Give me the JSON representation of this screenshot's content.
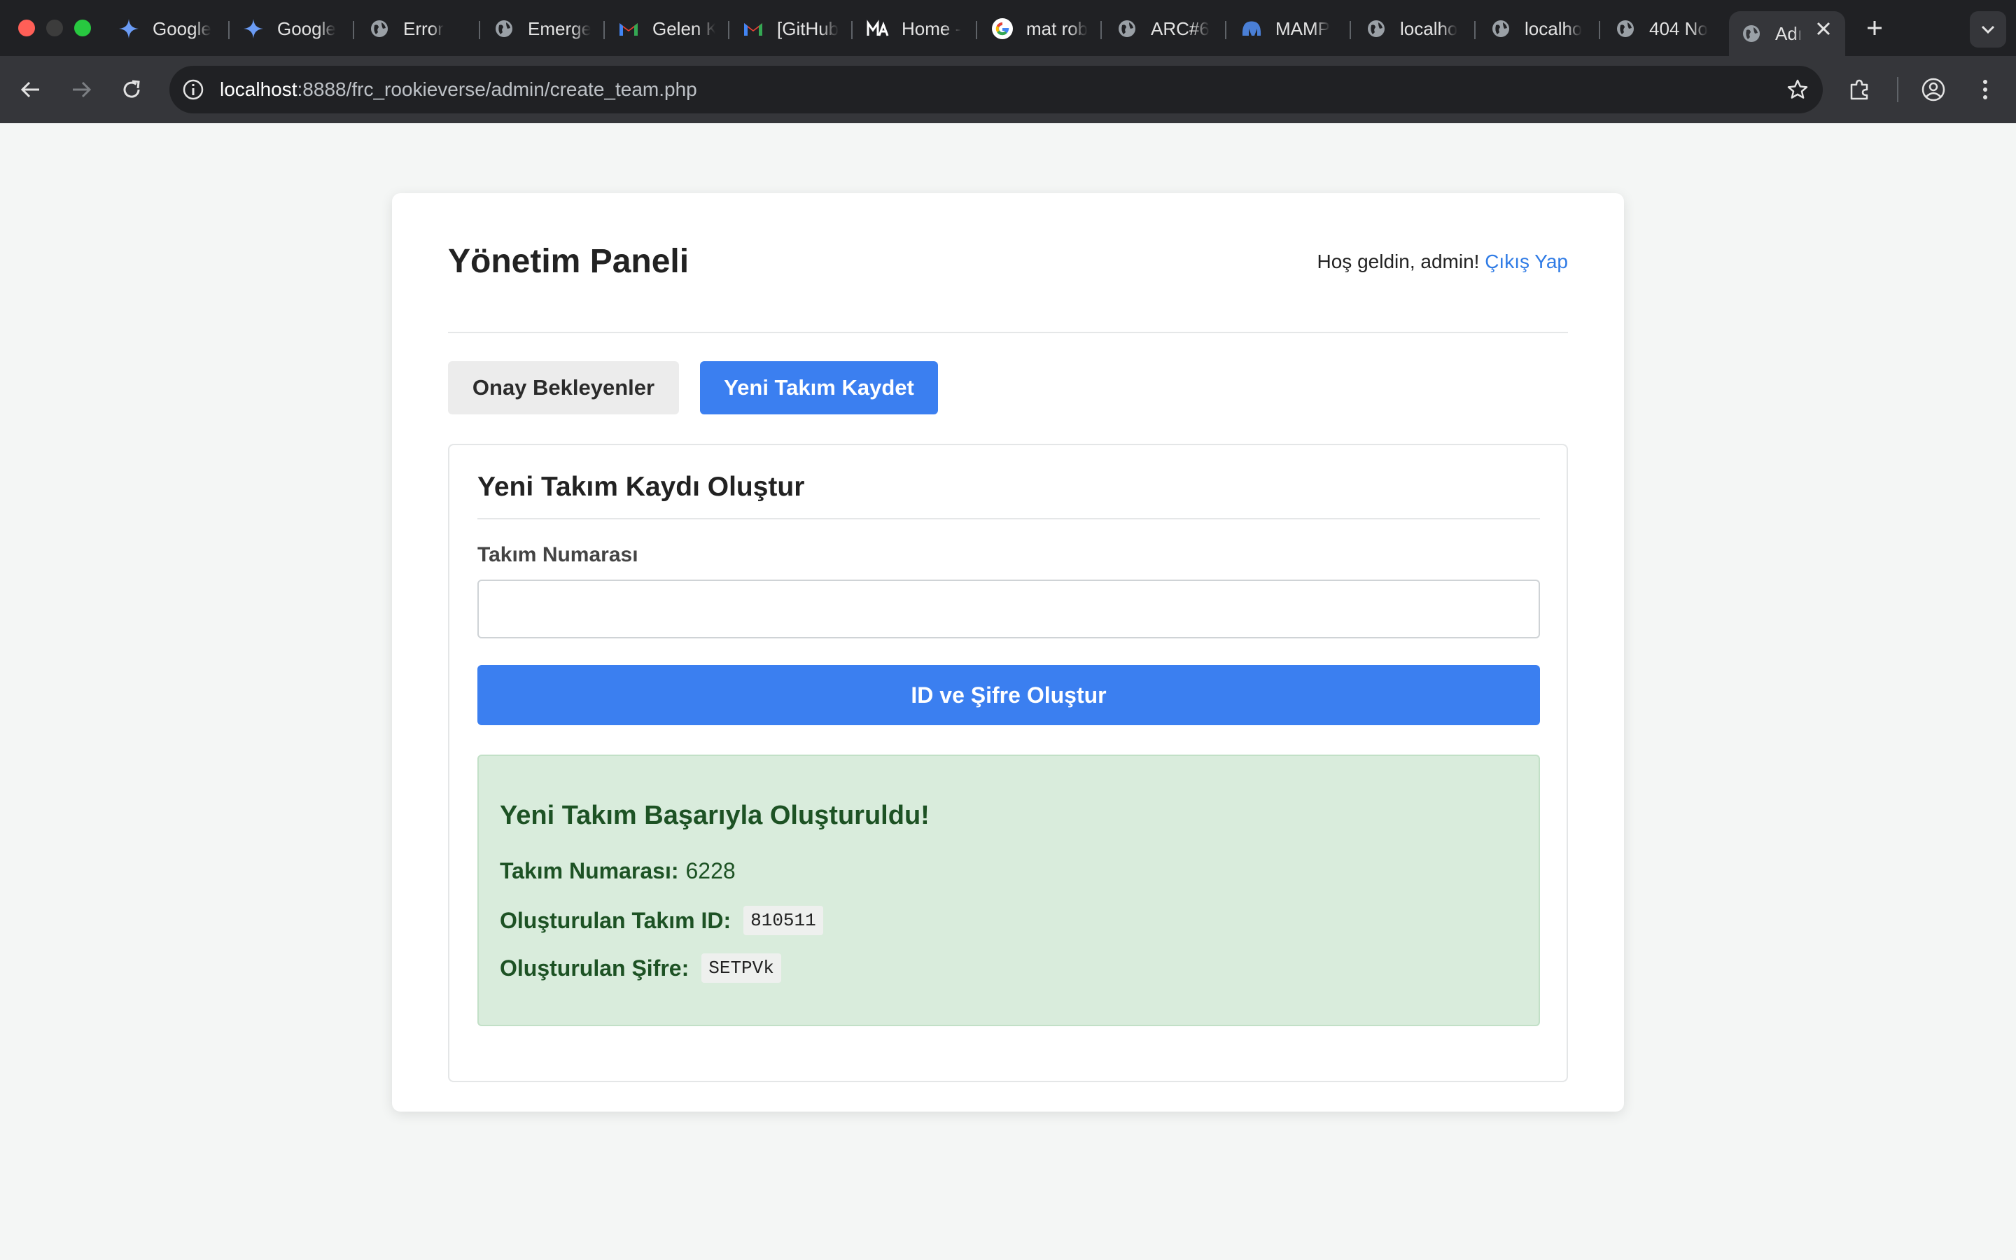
{
  "browser": {
    "tabs": [
      {
        "title": "Google",
        "icon": "gemini-icon"
      },
      {
        "title": "Google",
        "icon": "gemini-icon"
      },
      {
        "title": "Error",
        "icon": "globe-icon"
      },
      {
        "title": "Emerge",
        "icon": "globe-icon"
      },
      {
        "title": "Gelen K",
        "icon": "gmail-icon"
      },
      {
        "title": "[GitHub",
        "icon": "gmail-icon"
      },
      {
        "title": "Home -",
        "icon": "ma-logo-icon"
      },
      {
        "title": "mat rob",
        "icon": "google-icon"
      },
      {
        "title": "ARC#6",
        "icon": "globe-icon"
      },
      {
        "title": "MAMP",
        "icon": "mamp-icon"
      },
      {
        "title": "localho",
        "icon": "globe-icon"
      },
      {
        "title": "localho",
        "icon": "globe-icon"
      },
      {
        "title": "404 No",
        "icon": "globe-icon"
      },
      {
        "title": "Adı",
        "icon": "globe-icon"
      }
    ],
    "url_host": "localhost",
    "url_path": ":8888/frc_rookieverse/admin/create_team.php"
  },
  "header": {
    "title": "Yönetim Paneli",
    "welcome_text": "Hoş geldin, admin!",
    "logout_label": "Çıkış Yap"
  },
  "nav": {
    "pending_label": "Onay Bekleyenler",
    "new_team_label": "Yeni Takım Kaydet"
  },
  "form": {
    "title": "Yeni Takım Kaydı Oluştur",
    "team_number_label": "Takım Numarası",
    "team_number_value": "",
    "submit_label": "ID ve Şifre Oluştur"
  },
  "result": {
    "title": "Yeni Takım Başarıyla Oluşturuldu!",
    "team_number_label": "Takım Numarası:",
    "team_number_value": "6228",
    "team_id_label": "Oluşturulan Takım ID:",
    "team_id_value": "810511",
    "password_label": "Oluşturulan Şifre:",
    "password_value": "SETPVk"
  },
  "colors": {
    "accent": "#3b7ff0",
    "link": "#2f7be5",
    "success_bg": "#d9ecdc",
    "success_text": "#1d5224"
  }
}
